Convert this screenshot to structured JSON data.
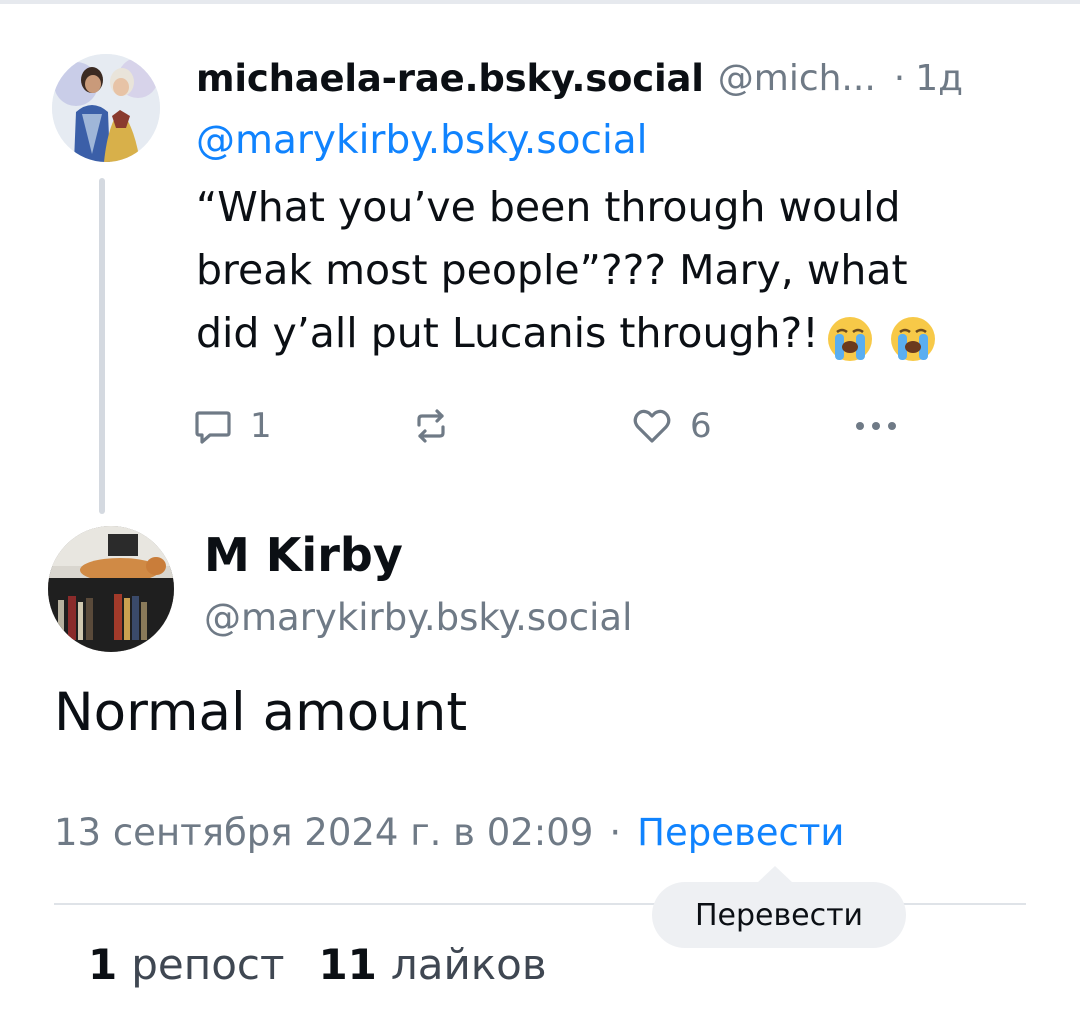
{
  "colors": {
    "accent": "#1083fe",
    "muted": "#6f7a86",
    "text": "#0b0f14",
    "thread_line": "#d4d9e0"
  },
  "parent_post": {
    "display_name": "michaela-rae.bsky.social",
    "handle_truncated": "@mich...",
    "separator": "·",
    "time_ago": "1д",
    "reply_mention": "@marykirby.bsky.social",
    "text_lines": [
      "“What you’ve been through would",
      "break most people”??? Mary, what",
      "did y’all put Lucanis through?!"
    ],
    "emojis": [
      "loudly-crying-face",
      "loudly-crying-face"
    ],
    "actions": {
      "reply": {
        "icon": "reply-icon",
        "count": "1"
      },
      "repost": {
        "icon": "repost-icon",
        "count": ""
      },
      "like": {
        "icon": "heart-icon",
        "count": "6"
      },
      "more": {
        "icon": "more-icon"
      }
    }
  },
  "main_post": {
    "display_name": "M Kirby",
    "handle": "@marykirby.bsky.social",
    "text": "Normal amount",
    "date": "13 сентября 2024 г. в 02:09",
    "separator": "·",
    "translate_label": "Перевести",
    "stats": {
      "reposts_count": "1",
      "reposts_label": "репост",
      "likes_count": "11",
      "likes_label": "лайков"
    }
  },
  "tooltip": {
    "text": "Перевести"
  }
}
